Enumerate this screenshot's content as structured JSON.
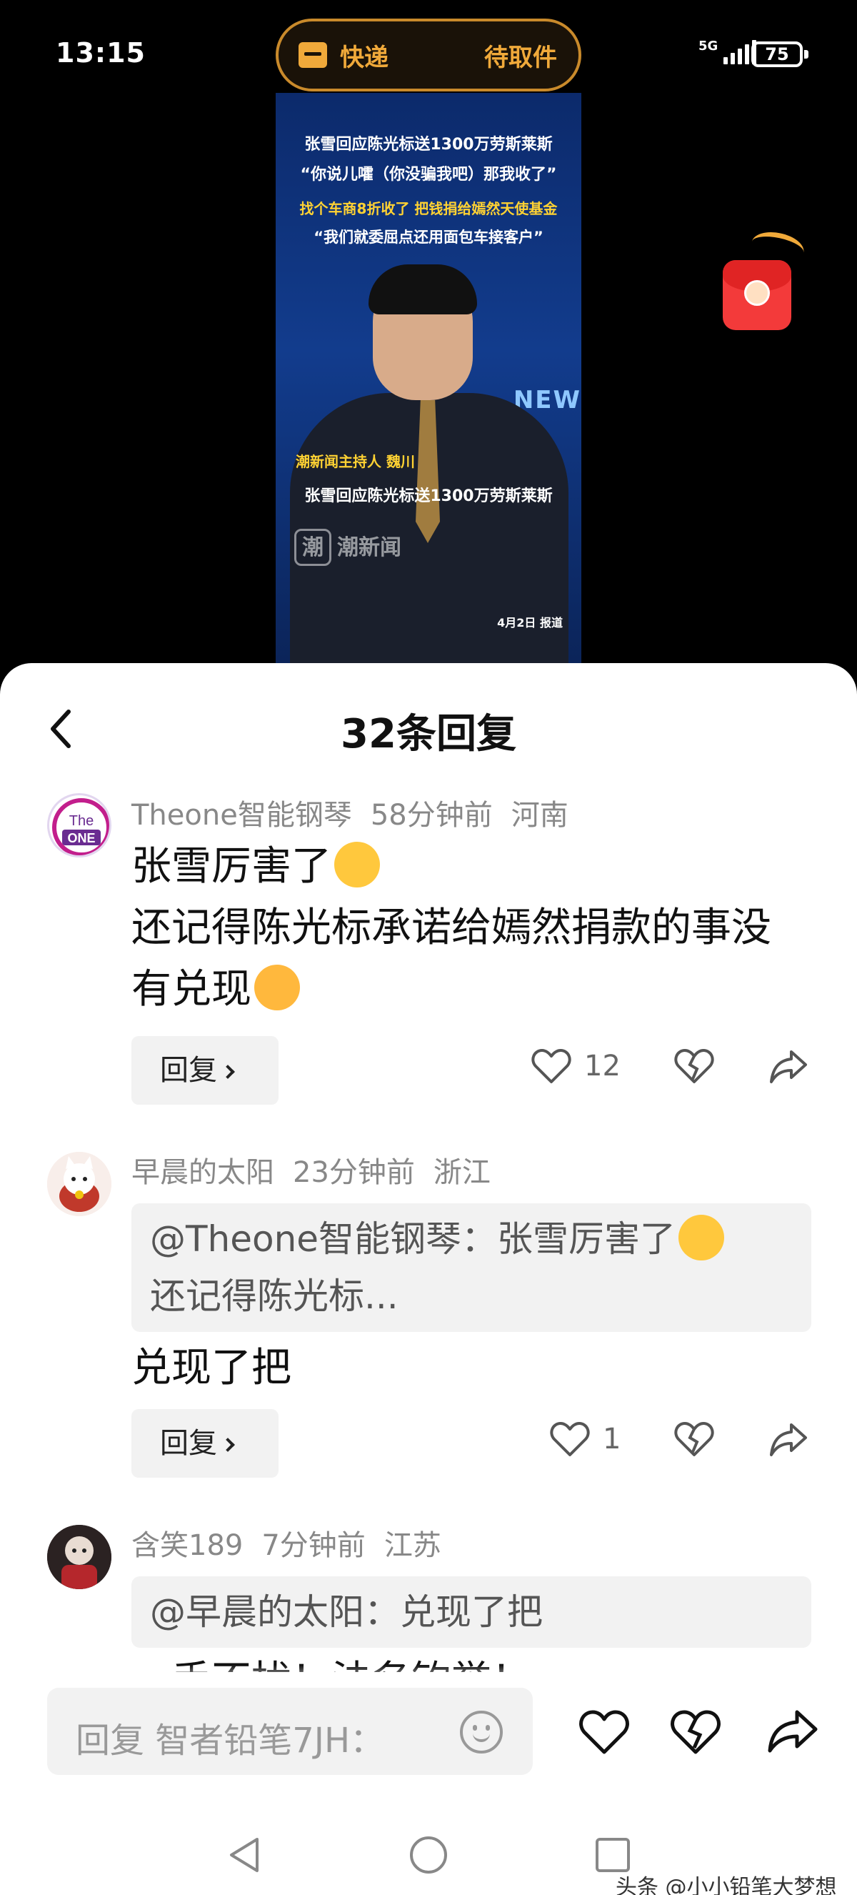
{
  "status": {
    "time": "13:15",
    "express_label": "快递",
    "express_status": "待取件",
    "network": "5G",
    "battery": "75"
  },
  "video": {
    "caption1": "张雪回应陈光标送1300万劳斯莱斯",
    "caption2": "“你说儿嚯（你没骗我吧）那我收了”",
    "caption3": "找个车商8折收了 把钱捐给嫣然天使基金",
    "caption4": "“我们就委屈点还用面包车接客户”",
    "host": "潮新闻主持人 魏川",
    "caption5": "张雪回应陈光标送1300万劳斯莱斯",
    "news_mark": "NEW",
    "logo": "潮新闻",
    "logo_char": "潮",
    "date": "4月2日 报道"
  },
  "sheet": {
    "title": "32条回复"
  },
  "comments": [
    {
      "user": "Theone智能钢琴",
      "time": "58分钟前",
      "location": "河南",
      "line1": "张雪厉害了",
      "line2": "还记得陈光标承诺给嫣然捐款的事没",
      "line3": "有兑现",
      "reply_label": "回复",
      "like_count": "12",
      "avatar_text": "The ONE"
    },
    {
      "user": "早晨的太阳",
      "time": "23分钟前",
      "location": "浙江",
      "quote_line1": "@Theone智能钢琴：张雪厉害了",
      "quote_line2": "还记得陈光标...",
      "text": "兑现了把",
      "reply_label": "回复",
      "like_count": "1"
    },
    {
      "user": "含笑189",
      "time": "7分钟前",
      "location": "江苏",
      "quote_line1": "@早晨的太阳：兑现了把",
      "text": "手不扰！法名钓誉！"
    }
  ],
  "input": {
    "placeholder": "回复 智者铅笔7JH："
  },
  "watermark": "头条 @小小铅笔大梦想",
  "colors": {
    "accent_gold": "#f0a93a",
    "envelope_red": "#f33a3a",
    "video_blue": "#123c8d"
  }
}
